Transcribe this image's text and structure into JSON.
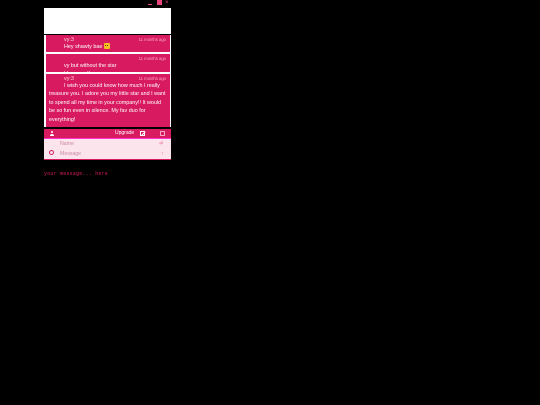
{
  "window_controls": {
    "close_glyph": "×"
  },
  "messages": [
    {
      "name": "vy:3",
      "time": "11 months ago",
      "text": "Hey shawty bae",
      "has_emoji": true
    },
    {
      "name": "",
      "time": "11 months ago",
      "line1": "vy but without the star",
      "line2": "I love you!!"
    },
    {
      "name": "vy:3",
      "time": "11 months ago",
      "text": "I wish you could know how much I really treasure you. I adore you my little star and I want to spend all my time in your company!! It would be so fun even in silence. My fav duo for everything!"
    }
  ],
  "toolbar": {
    "upgrade_label": "Upgrade"
  },
  "form": {
    "name_placeholder": "Name",
    "message_placeholder": "Message",
    "send_glyph": "⏎",
    "caret_glyph": "↑"
  },
  "hint": "your message... here",
  "colors": {
    "accent": "#d81b60",
    "form_bg": "#fce4ec",
    "page_bg": "#000000"
  }
}
